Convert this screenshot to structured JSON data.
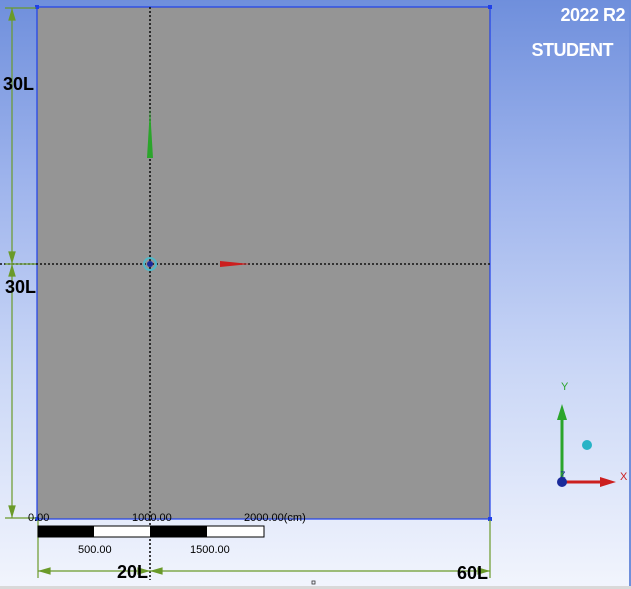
{
  "branding": {
    "version": "2022 R2",
    "license": "STUDENT"
  },
  "dimensions": {
    "left_upper": "30L",
    "left_lower": "30L",
    "bottom_left": "20L",
    "bottom_right": "60L"
  },
  "ruler": {
    "top_labels": [
      "0.00",
      "1000.00",
      "2000.00(cm)"
    ],
    "bottom_labels": [
      "500.00",
      "1500.00"
    ]
  },
  "triad": {
    "y_label": "Y",
    "x_label": "X",
    "z_label": "Z"
  },
  "colors": {
    "domain_fill": "#959595",
    "domain_edge": "#2040e8",
    "axis_x": "#cc1f1f",
    "axis_y": "#2ba52b",
    "axis_z": "#1a2a9a",
    "dimension_line": "#6a9a2a"
  }
}
